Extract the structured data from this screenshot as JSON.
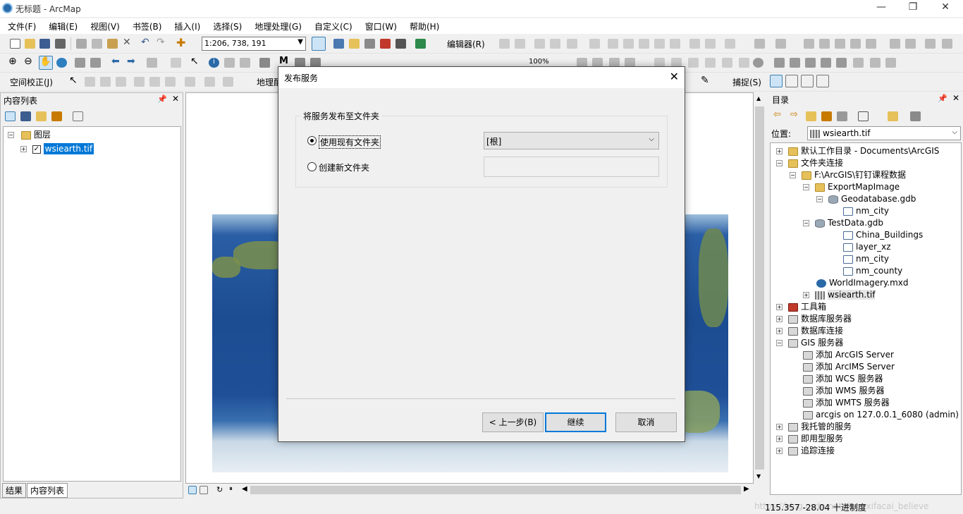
{
  "window": {
    "title": "无标题 - ArcMap",
    "minimize": "—",
    "restore": "❐",
    "close": "✕"
  },
  "menu": [
    "文件(F)",
    "编辑(E)",
    "视图(V)",
    "书签(B)",
    "插入(I)",
    "选择(S)",
    "地理处理(G)",
    "自定义(C)",
    "窗口(W)",
    "帮助(H)"
  ],
  "toolbar": {
    "scale": "1:206, 738, 191",
    "editor": "编辑器(R)",
    "georef": "空间校正(J)",
    "geo_label": "地理配",
    "snapping": "捕捉(S)",
    "zoom_pct": "100%"
  },
  "toc": {
    "title": "内容列表",
    "layers_label": "图层",
    "layer_name": "wsiearth.tif",
    "tab_results": "结果",
    "tab_toc": "内容列表"
  },
  "catalog": {
    "title": "目录",
    "location_label": "位置:",
    "location_value": "wsiearth.tif",
    "tree": [
      {
        "label": "默认工作目录 - Documents\\ArcGIS",
        "icon": "folder",
        "exp": "+"
      },
      {
        "label": "文件夹连接",
        "icon": "folder",
        "exp": "−"
      },
      {
        "label": "F:\\ArcGIS\\钉钉课程数据",
        "icon": "folder",
        "exp": "−"
      },
      {
        "label": "ExportMapImage",
        "icon": "folder",
        "exp": "−"
      },
      {
        "label": "Geodatabase.gdb",
        "icon": "gdb",
        "exp": "−"
      },
      {
        "label": "nm_city",
        "icon": "fc",
        "exp": ""
      },
      {
        "label": "TestData.gdb",
        "icon": "gdb",
        "exp": "−"
      },
      {
        "label": "China_Buildings",
        "icon": "fc",
        "exp": ""
      },
      {
        "label": "layer_xz",
        "icon": "fc",
        "exp": ""
      },
      {
        "label": "nm_city",
        "icon": "fc",
        "exp": ""
      },
      {
        "label": "nm_county",
        "icon": "fc",
        "exp": ""
      },
      {
        "label": "WorldImagery.mxd",
        "icon": "mxd",
        "exp": ""
      },
      {
        "label": "wsiearth.tif",
        "icon": "raster",
        "exp": "+"
      },
      {
        "label": "工具箱",
        "icon": "tool",
        "exp": "+"
      },
      {
        "label": "数据库服务器",
        "icon": "srv",
        "exp": "+"
      },
      {
        "label": "数据库连接",
        "icon": "srv",
        "exp": "+"
      },
      {
        "label": "GIS 服务器",
        "icon": "srv",
        "exp": "−"
      },
      {
        "label": "添加 ArcGIS Server",
        "icon": "srv",
        "exp": ""
      },
      {
        "label": "添加 ArcIMS Server",
        "icon": "srv",
        "exp": ""
      },
      {
        "label": "添加 WCS 服务器",
        "icon": "srv",
        "exp": ""
      },
      {
        "label": "添加 WMS 服务器",
        "icon": "srv",
        "exp": ""
      },
      {
        "label": "添加 WMTS 服务器",
        "icon": "srv",
        "exp": ""
      },
      {
        "label": "arcgis on 127.0.0.1_6080 (admin)",
        "icon": "srv",
        "exp": ""
      },
      {
        "label": "我托管的服务",
        "icon": "srv",
        "exp": "+"
      },
      {
        "label": "即用型服务",
        "icon": "srv",
        "exp": "+"
      },
      {
        "label": "追踪连接",
        "icon": "srv",
        "exp": "+"
      }
    ]
  },
  "dialog": {
    "title": "发布服务",
    "group_label": "将服务发布至文件夹",
    "opt_existing": "使用现有文件夹",
    "opt_new": "创建新文件夹",
    "folder_value": "[根]",
    "btn_back": "< 上一步(B)",
    "btn_continue": "继续",
    "btn_cancel": "取消"
  },
  "status": {
    "coords": "115.357  -28.04 十进制度",
    "watermark": "https://blog.csdn.net/dongxifacai_believe"
  }
}
